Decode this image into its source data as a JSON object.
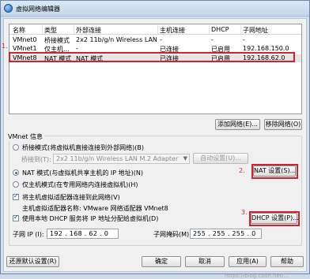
{
  "window": {
    "title": "虚拟网络编辑器"
  },
  "table": {
    "headers": [
      "名称",
      "类型",
      "外部连接",
      "主机连接",
      "DHCP",
      "子网地址"
    ],
    "rows": [
      [
        "VMnet0",
        "桥接模式",
        "2x2 11b/g/n Wireless LAN M...",
        "-",
        "-",
        "-"
      ],
      [
        "VMnet1",
        "仅主机...",
        "-",
        "已连接",
        "已启用",
        "192.168.150.0"
      ],
      [
        "VMnet8",
        "NAT 模式",
        "NAT 模式",
        "已连接",
        "已启用",
        "192.168.62.0"
      ]
    ],
    "selected_row": 2
  },
  "annotations": [
    "1.",
    "2.",
    "3."
  ],
  "buttons": {
    "add_network": "添加网络(E)...",
    "remove_network": "移除网络(O)",
    "auto_settings": "自动设置(U)...",
    "nat_settings": "NAT 设置(S)...",
    "dhcp_settings": "DHCP 设置(P)...",
    "restore_defaults": "还原默认设置(R)",
    "ok": "确定",
    "cancel": "取消",
    "apply": "应用(A)",
    "help": "帮助"
  },
  "vmnet_info": {
    "title": "VMnet 信息",
    "bridged_option": "桥接模式(将虚拟机直接连接到外部网络)(B)",
    "bridged_to_label": "桥接到(T):",
    "bridged_to_value": "2x2 11b/g/n Wireless LAN M.2 Adapter",
    "nat_option": "NAT 模式(与虚拟机共享主机的 IP 地址)(N)",
    "host_only_option": "仅主机模式(在专用网络内连接虚拟机)(H)",
    "connect_adapter": "将主机虚拟适配器连接到此网络(V)",
    "adapter_name": "主机虚拟适配器名称: VMware 网络适配器 VMnet8",
    "use_dhcp": "使用本地 DHCP 服务将 IP 地址分配给虚拟机(D)",
    "selected_mode": "nat",
    "connect_adapter_checked": true,
    "use_dhcp_checked": true
  },
  "subnet": {
    "ip_label": "子网 IP (I):",
    "ip_value": "192 . 168 . 62 . 0",
    "mask_label": "子网掩码(M):",
    "mask_value": "255 . 255 . 255 . 0"
  },
  "watermark": "https://blog.csdn.net/..."
}
